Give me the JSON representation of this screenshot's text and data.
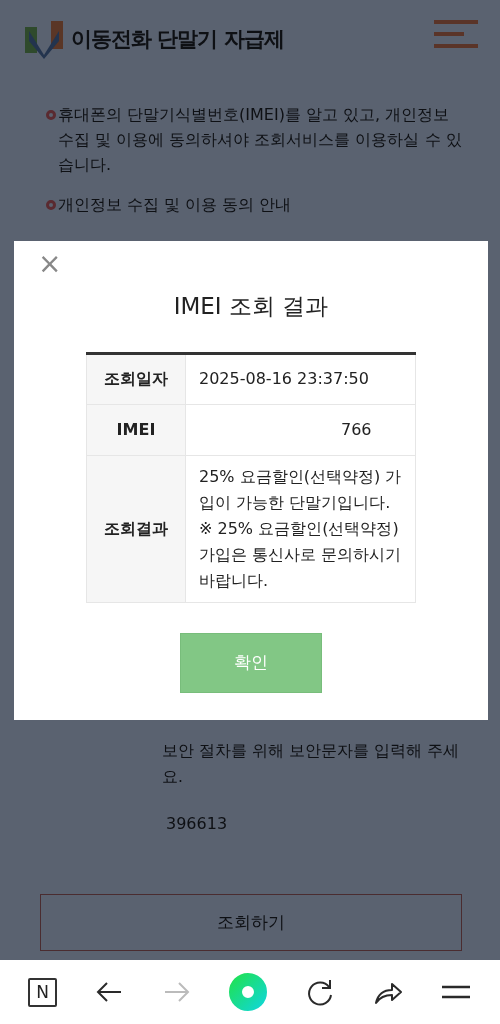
{
  "header": {
    "title": "이동전화 단말기 자급제"
  },
  "notices": [
    {
      "text": "휴대폰의 단말기식별번호(IMEI)를 알고 있고, 개인정보 수집 및 이용에 동의하셔야 조회서비스를 이용하실 수 있습니다."
    },
    {
      "text": "개인정보 수집 및 이용 동의 안내"
    }
  ],
  "captcha": {
    "hint": "보안 절차를 위해 보안문자를 입력해 주세요.",
    "code": "396613"
  },
  "submit_button": "조회하기",
  "modal": {
    "close": "×",
    "title": "IMEI 조회 결과",
    "rows": [
      {
        "label": "조회일자",
        "kind": "plain",
        "lines": [
          "2025-08-16 23:37:50"
        ]
      },
      {
        "label": "IMEI",
        "kind": "masked",
        "lines": [
          "766"
        ]
      },
      {
        "label": "조회결과",
        "kind": "plain",
        "lines": [
          "25% 요금할인(선택약정) 가입이 가능한 단말기입니다.",
          "※ 25% 요금할인(선택약정) 가입은 통신사로 문의하시기 바랍니다."
        ]
      }
    ],
    "confirm_button": "확인"
  },
  "browser_toolbar": [
    {
      "kind": "logo",
      "label": "N",
      "disabled": false
    },
    {
      "kind": "back",
      "disabled": false
    },
    {
      "kind": "forward",
      "disabled": true
    },
    {
      "kind": "home",
      "disabled": false
    },
    {
      "kind": "reload",
      "disabled": false
    },
    {
      "kind": "share",
      "disabled": false
    },
    {
      "kind": "menu",
      "disabled": false
    }
  ]
}
